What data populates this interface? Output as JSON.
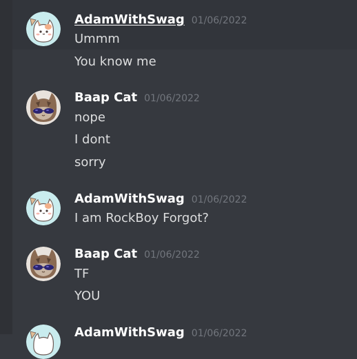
{
  "messages": [
    {
      "author": "AdamWithSwag",
      "timestamp": "01/06/2022",
      "avatar": "white-cat-avatar",
      "lines": [
        "Ummm",
        "You know me"
      ]
    },
    {
      "author": "Baap Cat",
      "timestamp": "01/06/2022",
      "avatar": "cat-with-sunglasses-avatar",
      "lines": [
        "nope",
        "I dont",
        "sorry"
      ]
    },
    {
      "author": "AdamWithSwag",
      "timestamp": "01/06/2022",
      "avatar": "white-cat-avatar",
      "lines": [
        "I am RockBoy Forgot?"
      ]
    },
    {
      "author": "Baap Cat",
      "timestamp": "01/06/2022",
      "avatar": "cat-with-sunglasses-avatar",
      "lines": [
        "TF",
        "YOU"
      ]
    },
    {
      "author": "AdamWithSwag",
      "timestamp": "01/06/2022",
      "avatar": "white-cat-avatar",
      "lines": []
    }
  ],
  "colors": {
    "background": "#36393f",
    "hover": "#32353b",
    "username": "#ffffff",
    "text": "#dcddde",
    "timestamp": "#72767d"
  }
}
